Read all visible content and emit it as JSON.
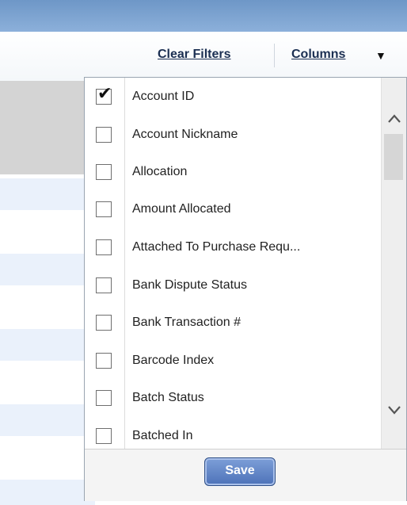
{
  "toolbar": {
    "clear_filters": "Clear Filters",
    "columns": "Columns",
    "columns_icon": "triangle-down-icon"
  },
  "column_picker": {
    "items": [
      {
        "label": "Account ID",
        "checked": true
      },
      {
        "label": "Account Nickname",
        "checked": false
      },
      {
        "label": "Allocation",
        "checked": false
      },
      {
        "label": "Amount Allocated",
        "checked": false
      },
      {
        "label": "Attached To Purchase Requ...",
        "checked": false
      },
      {
        "label": "Bank Dispute Status",
        "checked": false
      },
      {
        "label": "Bank Transaction #",
        "checked": false
      },
      {
        "label": "Barcode Index",
        "checked": false
      },
      {
        "label": "Batch Status",
        "checked": false
      },
      {
        "label": "Batched In",
        "checked": false
      }
    ],
    "save_label": "Save"
  },
  "colors": {
    "topbar": "#8cb0da",
    "alt_row": "#eaf1fb",
    "save_button": "#4d72b8"
  }
}
